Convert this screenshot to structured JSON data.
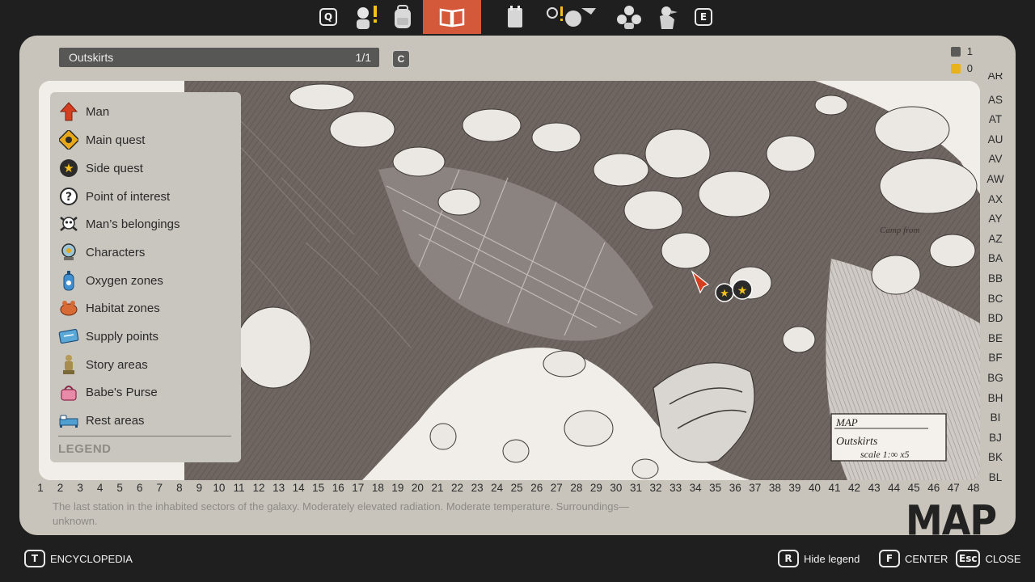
{
  "top_tabs": {
    "prev_key": "Q",
    "next_key": "E",
    "items": [
      {
        "icon": "man-alert-icon"
      },
      {
        "icon": "backpack-icon"
      },
      {
        "icon": "open-book-icon",
        "active": true
      },
      {
        "icon": "notebook-icon"
      },
      {
        "icon": "crafting-icon"
      },
      {
        "icon": "characters-icon"
      },
      {
        "icon": "bird-icon"
      }
    ]
  },
  "location": {
    "name": "Outskirts",
    "page": "1/1",
    "cycle_key": "C"
  },
  "counters": [
    {
      "icon": "document-icon",
      "value": "1"
    },
    {
      "icon": "radiation-icon",
      "value": "0"
    }
  ],
  "legend": {
    "title": "LEGEND",
    "items": [
      {
        "label": "Man",
        "icon": "red-arrow-icon"
      },
      {
        "label": "Main quest",
        "icon": "main-quest-icon"
      },
      {
        "label": "Side quest",
        "icon": "side-quest-star-icon"
      },
      {
        "label": "Point of interest",
        "icon": "question-mark-icon"
      },
      {
        "label": "Man’s belongings",
        "icon": "skull-crossbones-icon"
      },
      {
        "label": "Characters",
        "icon": "globe-character-icon"
      },
      {
        "label": "Oxygen zones",
        "icon": "oxygen-tank-icon"
      },
      {
        "label": "Habitat zones",
        "icon": "habitat-creature-icon"
      },
      {
        "label": "Supply points",
        "icon": "supply-ticket-icon"
      },
      {
        "label": "Story areas",
        "icon": "statue-icon"
      },
      {
        "label": "Babe's Purse",
        "icon": "purse-icon"
      },
      {
        "label": "Rest areas",
        "icon": "bed-icon"
      }
    ]
  },
  "map": {
    "row_labels": [
      "AR",
      "AS",
      "AT",
      "AU",
      "AV",
      "AW",
      "AX",
      "AY",
      "AZ",
      "BA",
      "BB",
      "BC",
      "BD",
      "BE",
      "BF",
      "BG",
      "BH",
      "BI",
      "BJ",
      "BK",
      "BL"
    ],
    "col_labels": [
      "1",
      "2",
      "3",
      "4",
      "5",
      "6",
      "7",
      "8",
      "9",
      "10",
      "11",
      "12",
      "13",
      "14",
      "15",
      "16",
      "17",
      "18",
      "19",
      "20",
      "21",
      "22",
      "23",
      "24",
      "25",
      "26",
      "27",
      "28",
      "29",
      "30",
      "31",
      "32",
      "33",
      "34",
      "35",
      "36",
      "37",
      "38",
      "39",
      "40",
      "41",
      "42",
      "43",
      "44",
      "45",
      "46",
      "47",
      "48"
    ],
    "sketch_note": "Camp from",
    "cartouche": {
      "title": "MAP",
      "name": "Outskirts",
      "scale": "scale 1:∞ x5"
    }
  },
  "description": "The last station in the inhabited sectors of the galaxy. Moderately elevated radiation. Moderate temperature. Surroundings—unknown.",
  "panel_title": "MAP",
  "bottom": {
    "encyclopedia": {
      "key": "T",
      "label": "ENCYCLOPEDIA"
    },
    "hide_legend": {
      "key": "R",
      "label": "Hide legend"
    },
    "center": {
      "key": "F",
      "label": "CENTER"
    },
    "close": {
      "key": "Esc",
      "label": "CLOSE"
    }
  },
  "colors": {
    "accent": "#d4583a",
    "panel": "#c8c4bc",
    "background": "#1f1f1f"
  }
}
